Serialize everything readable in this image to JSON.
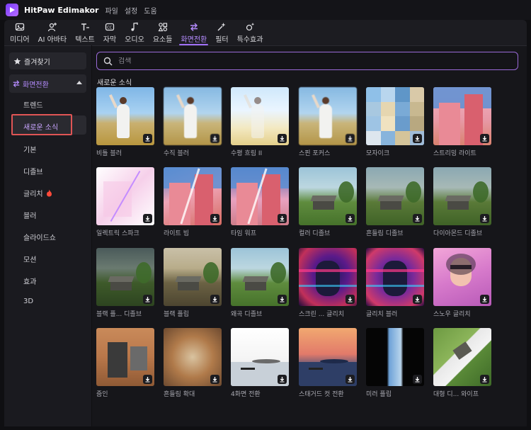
{
  "app": {
    "name": "HitPaw Edimakor",
    "menu": [
      "파일",
      "설정",
      "도움"
    ]
  },
  "toolbar": {
    "tools": [
      {
        "label": "미디어",
        "icon": "media-icon"
      },
      {
        "label": "AI 아바타",
        "icon": "ai-avatar-icon"
      },
      {
        "label": "텍스트",
        "icon": "text-icon"
      },
      {
        "label": "자막",
        "icon": "subtitle-icon"
      },
      {
        "label": "오디오",
        "icon": "audio-icon"
      },
      {
        "label": "요소들",
        "icon": "elements-icon"
      },
      {
        "label": "화면전환",
        "icon": "transition-icon"
      },
      {
        "label": "필터",
        "icon": "filter-icon"
      },
      {
        "label": "특수효과",
        "icon": "effects-icon"
      }
    ],
    "active": "화면전환"
  },
  "sidebar": {
    "favorites": "즐겨찾기",
    "category": "화면전환",
    "items": [
      "트렌드",
      "새로운 소식",
      "기본",
      "디졸브",
      "글리치",
      "블러",
      "슬라이드쇼",
      "모션",
      "효과",
      "3D"
    ],
    "selected": "새로운 소식"
  },
  "search": {
    "placeholder": "검색"
  },
  "section": {
    "title": "새로운 소식"
  },
  "cards": [
    {
      "label": "비틀 블러",
      "art": "dancer"
    },
    {
      "label": "수직 블러",
      "art": "dancer-blur"
    },
    {
      "label": "수평 흐림 II",
      "art": "bright"
    },
    {
      "label": "스핀 포커스",
      "art": "dancer-blur"
    },
    {
      "label": "모자이크",
      "art": "mosaic"
    },
    {
      "label": "스트리밍 라이트",
      "art": "pink"
    },
    {
      "label": "일렉트릭 스파크",
      "art": "white"
    },
    {
      "label": "라이트 빔",
      "art": "redwall"
    },
    {
      "label": "타임 워프",
      "art": "warp"
    },
    {
      "label": "컬러 디졸브",
      "art": "house"
    },
    {
      "label": "흔들림 디졸브",
      "art": "house-dim"
    },
    {
      "label": "다이아몬드 디졸브",
      "art": "house-dim"
    },
    {
      "label": "블랙 플... 디졸브",
      "art": "house-dark"
    },
    {
      "label": "블랙 플립",
      "art": "house-sepia"
    },
    {
      "label": "왜곡 디졸브",
      "art": "house"
    },
    {
      "label": "스크린 ... 글리치",
      "art": "glitch"
    },
    {
      "label": "글리치 블러",
      "art": "glitch2"
    },
    {
      "label": "스노우 글리치",
      "art": "face"
    },
    {
      "label": "줌인",
      "art": "door"
    },
    {
      "label": "흔들림 확대",
      "art": "blurzoom"
    },
    {
      "label": "4화면 전환",
      "art": "sea"
    },
    {
      "label": "스태거드 컷 전환",
      "art": "sunset"
    },
    {
      "label": "미러 플립",
      "art": "mirror"
    },
    {
      "label": "대형 디... 와이프",
      "art": "wipe"
    }
  ],
  "colors": {
    "accent": "#a070ff",
    "accent_text": "#b58cff",
    "highlight_box": "#e05555",
    "background": "#0f0f12"
  }
}
